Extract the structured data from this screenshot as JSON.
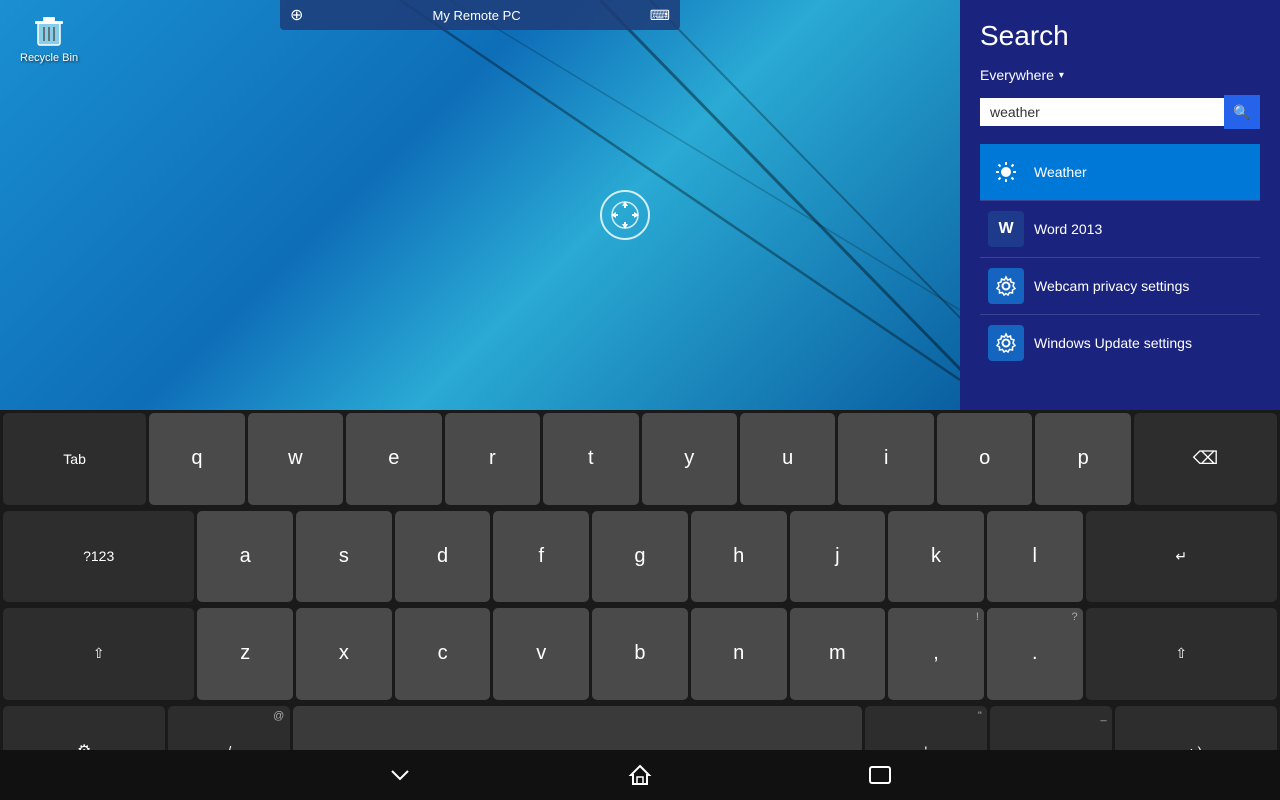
{
  "desktop": {
    "background": "blue gradient"
  },
  "recycle_bin": {
    "label": "Recycle Bin"
  },
  "remote_toolbar": {
    "title": "My Remote PC"
  },
  "search_panel": {
    "title": "Search",
    "scope": "Everywhere",
    "input_value": "weather",
    "search_button_icon": "🔍",
    "results": [
      {
        "id": "weather",
        "label": "Weather",
        "icon_type": "weather",
        "icon": "☀"
      },
      {
        "id": "word2013",
        "label": "Word 2013",
        "icon_type": "word",
        "icon": "W"
      },
      {
        "id": "webcam",
        "label": "Webcam privacy settings",
        "icon_type": "gear",
        "icon": "⚙"
      },
      {
        "id": "windowsupdate",
        "label": "Windows Update settings",
        "icon_type": "gear",
        "icon": "⚙"
      }
    ]
  },
  "keyboard": {
    "row1": [
      "q",
      "w",
      "e",
      "r",
      "t",
      "y",
      "u",
      "i",
      "o",
      "p"
    ],
    "row2": [
      "a",
      "s",
      "d",
      "f",
      "g",
      "h",
      "j",
      "k",
      "l"
    ],
    "row3": [
      "z",
      "x",
      "c",
      "v",
      "b",
      "n",
      "m",
      ",",
      "."
    ],
    "tab_label": "Tab",
    "numbers_label": "?123",
    "backspace_icon": "⌫",
    "enter_icon": "↵",
    "shift_icon": "⇧",
    "settings_icon": "⚙",
    "slash_label": "/",
    "apostrophe_label": "'",
    "dash_label": "-",
    "emoji_label": ":-)",
    "space_label": ""
  },
  "navbar": {
    "back_icon": "⌄",
    "home_icon": "⌂",
    "recent_icon": "▭"
  }
}
